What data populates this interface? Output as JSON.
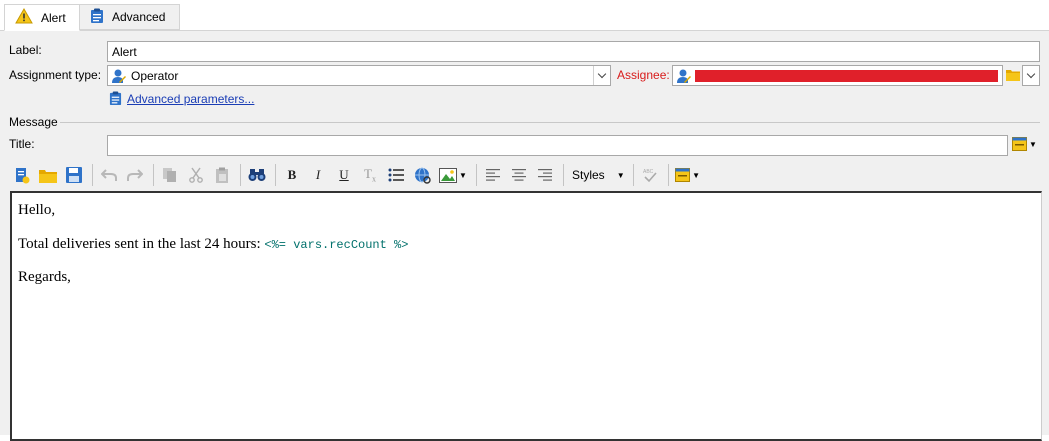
{
  "tabs": [
    {
      "label": "Alert",
      "icon": "warning-icon"
    },
    {
      "label": "Advanced",
      "icon": "clipboard-icon"
    }
  ],
  "form": {
    "label_label": "Label:",
    "label_value": "Alert",
    "assignment_label": "Assignment type:",
    "assignment_value": "Operator",
    "assignee_label": "Assignee:",
    "advanced_link": "Advanced parameters...",
    "message_section": "Message",
    "title_label": "Title:",
    "title_value": ""
  },
  "toolbar": {
    "styles_label": "Styles"
  },
  "editor": {
    "greeting": "Hello,",
    "line_text": "Total deliveries sent in the last 24 hours: ",
    "line_code": "<%= vars.recCount %>",
    "closing": "Regards,"
  },
  "colors": {
    "assignee_label": "#d81b1b",
    "redaction": "#e0202a",
    "link": "#1a3db5",
    "code": "#00706b"
  }
}
